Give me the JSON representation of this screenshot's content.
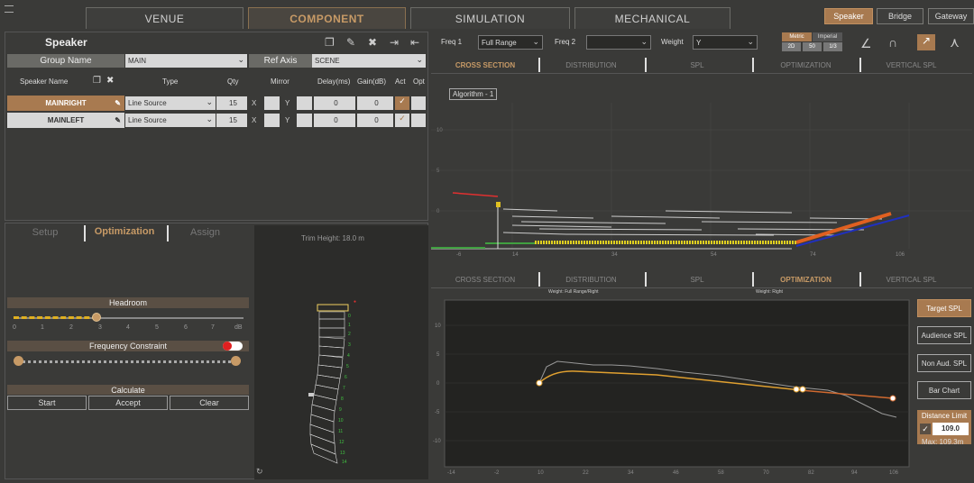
{
  "top_tabs": [
    {
      "label": "VENUE",
      "active": false
    },
    {
      "label": "COMPONENT",
      "active": true
    },
    {
      "label": "SIMULATION",
      "active": false
    },
    {
      "label": "MECHANICAL",
      "active": false
    }
  ],
  "right_tabs": [
    {
      "label": "Speaker",
      "active": true
    },
    {
      "label": "Bridge",
      "active": false
    },
    {
      "label": "Gateway",
      "active": false
    }
  ],
  "speaker_panel": {
    "title": "Speaker",
    "group_name_label": "Group Name",
    "group_name_value": "MAIN",
    "ref_axis_label": "Ref Axis",
    "ref_axis_value": "SCENE",
    "columns": [
      "Speaker Name",
      "Type",
      "Qty",
      "Mirror",
      "Delay(ms)",
      "Gain(dB)",
      "Act",
      "Opt"
    ],
    "rows": [
      {
        "name": "MAINRIGHT",
        "type": "Line Source",
        "qty": "15",
        "mirror_x": "X",
        "mirror_y": "Y",
        "delay": "0",
        "gain": "0",
        "selected": true
      },
      {
        "name": "MAINLEFT",
        "type": "Line Source",
        "qty": "15",
        "mirror_x": "X",
        "mirror_y": "Y",
        "delay": "0",
        "gain": "0",
        "selected": false
      }
    ]
  },
  "bottom_left_tabs": [
    {
      "label": "Setup",
      "active": false
    },
    {
      "label": "Optimization",
      "active": true
    },
    {
      "label": "Assign",
      "active": false
    }
  ],
  "optimization": {
    "headroom_label": "Headroom",
    "headroom_ticks": [
      "0",
      "1",
      "2",
      "3",
      "4",
      "5",
      "6",
      "7",
      "dB"
    ],
    "headroom_value": 3,
    "freq_constraint_label": "Frequency Constraint",
    "calculate_label": "Calculate",
    "start_label": "Start",
    "accept_label": "Accept",
    "clear_label": "Clear"
  },
  "array_view": {
    "title": "Trim Height: 18.0 m"
  },
  "freq_bar": {
    "freq1_label": "Freq 1",
    "freq1_value": "Full Range",
    "freq2_label": "Freq 2",
    "freq2_value": "",
    "weight_label": "Weight",
    "weight_value": "Y",
    "metric_label": "Metric",
    "imperial_label": "Imperial",
    "units": [
      "2D",
      "50",
      "1/3"
    ]
  },
  "upper_view_tabs": [
    {
      "label": "CROSS SECTION",
      "active": true
    },
    {
      "label": "DISTRIBUTION",
      "active": false
    },
    {
      "label": "SPL",
      "active": false
    },
    {
      "label": "OPTIMIZATION",
      "active": false
    },
    {
      "label": "VERTICAL SPL",
      "active": false
    }
  ],
  "cross_section": {
    "algorithm_label": "Algorithm - 1",
    "x_ticks": [
      "-6",
      "4",
      "14",
      "24",
      "34",
      "44",
      "54",
      "64",
      "74",
      "84",
      "94",
      "106",
      "116"
    ]
  },
  "lower_view_tabs": [
    {
      "label": "CROSS SECTION",
      "active": false
    },
    {
      "label": "DISTRIBUTION",
      "active": false
    },
    {
      "label": "SPL",
      "active": false
    },
    {
      "label": "OPTIMIZATION",
      "active": true
    },
    {
      "label": "VERTICAL SPL",
      "active": false
    }
  ],
  "opt_chart": {
    "header_left": "Weight: Full Range/Right",
    "header_right": "Weight: Right",
    "y_ticks": [
      "10",
      "5",
      "0",
      "-5",
      "-10"
    ],
    "x_ticks": [
      "-14",
      "-2",
      "10",
      "22",
      "34",
      "46",
      "58",
      "70",
      "82",
      "94",
      "106"
    ],
    "colors": {
      "target": "#e0a030",
      "measured": "#999999",
      "limit": "#d06a30"
    }
  },
  "side_buttons": [
    {
      "label": "Target SPL",
      "active": true
    },
    {
      "label": "Audience SPL",
      "active": false
    },
    {
      "label": "Non Aud. SPL",
      "active": false
    },
    {
      "label": "Bar Chart",
      "active": false
    }
  ],
  "distance_limit": {
    "label": "Distance Limit",
    "value": "109.0",
    "max": "Max: 109.3m"
  }
}
